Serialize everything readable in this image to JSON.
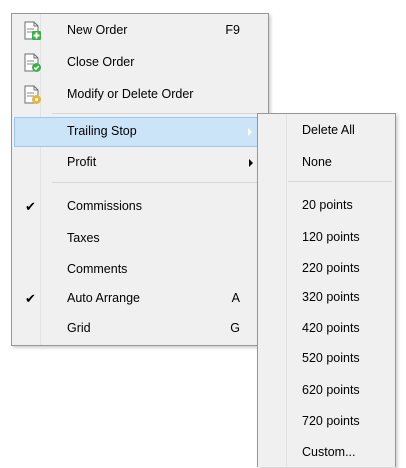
{
  "main_menu": {
    "new_order": {
      "label": "New Order",
      "shortcut": "F9",
      "icon": "document-plus-icon"
    },
    "close_order": {
      "label": "Close Order",
      "icon": "document-check-icon"
    },
    "modify_order": {
      "label": "Modify or Delete Order",
      "icon": "document-edit-icon"
    },
    "trailing_stop": {
      "label": "Trailing Stop"
    },
    "profit": {
      "label": "Profit"
    },
    "commissions": {
      "label": "Commissions",
      "checked": true
    },
    "taxes": {
      "label": "Taxes",
      "checked": false
    },
    "comments": {
      "label": "Comments",
      "checked": false
    },
    "auto_arrange": {
      "label": "Auto Arrange",
      "shortcut": "A",
      "checked": true
    },
    "grid": {
      "label": "Grid",
      "shortcut": "G",
      "checked": false
    }
  },
  "submenu": {
    "delete_all": "Delete All",
    "none": "None",
    "points": [
      "20 points",
      "120 points",
      "220 points",
      "320 points",
      "420 points",
      "520 points",
      "620 points",
      "720 points"
    ],
    "custom": "Custom..."
  },
  "colors": {
    "highlight_bg": "#cce4f7",
    "highlight_border": "#99c9ef",
    "menu_bg": "#f0f0f0",
    "check": "✔"
  }
}
